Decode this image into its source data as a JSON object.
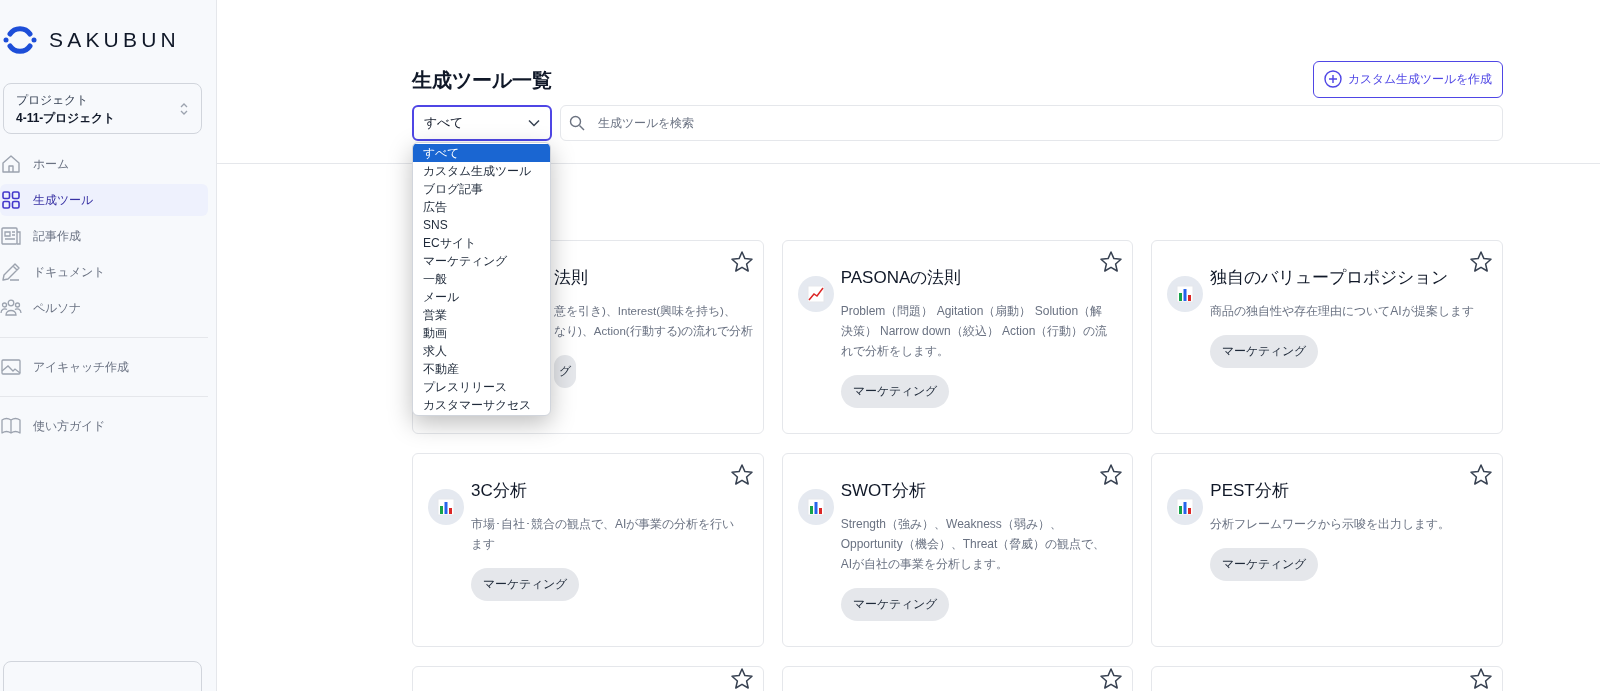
{
  "brand": "SAKUBUN",
  "project": {
    "label": "プロジェクト",
    "value": "4-11-プロジェクト"
  },
  "nav_sections": [
    {
      "items": [
        {
          "label": "ホーム",
          "selected": false
        },
        {
          "label": "生成ツール",
          "selected": true
        },
        {
          "label": "記事作成",
          "selected": false
        },
        {
          "label": "ドキュメント",
          "selected": false
        },
        {
          "label": "ペルソナ",
          "selected": false
        }
      ]
    },
    {
      "items": [
        {
          "label": "アイキャッチ作成",
          "selected": false
        }
      ]
    },
    {
      "items": [
        {
          "label": "使い方ガイド",
          "selected": false
        }
      ]
    }
  ],
  "page_title": "生成ツール一覧",
  "create_button": "カスタム生成ツールを作成",
  "category_select": {
    "value": "すべて",
    "expanded": true,
    "options": [
      {
        "label": "すべて",
        "selected": true
      },
      {
        "label": "カスタム生成ツール",
        "selected": false
      },
      {
        "label": "ブログ記事",
        "selected": false
      },
      {
        "label": "広告",
        "selected": false
      },
      {
        "label": "SNS",
        "selected": false
      },
      {
        "label": "ECサイト",
        "selected": false
      },
      {
        "label": "マーケティング",
        "selected": false
      },
      {
        "label": "一般",
        "selected": false
      },
      {
        "label": "メール",
        "selected": false
      },
      {
        "label": "営業",
        "selected": false
      },
      {
        "label": "動画",
        "selected": false
      },
      {
        "label": "求人",
        "selected": false
      },
      {
        "label": "不動産",
        "selected": false
      },
      {
        "label": "プレスリリース",
        "selected": false
      },
      {
        "label": "カスタマーサクセス",
        "selected": false
      }
    ]
  },
  "search": {
    "placeholder": "生成ツールを検索"
  },
  "cards": [
    {
      "kind": "covered",
      "title": "法則",
      "description": [
        "意を引き)、Interest(興味を持ち)、",
        "なり)、Action(行動する)の流れで分析"
      ],
      "tag": "グ"
    },
    {
      "kind": "trend",
      "title": "PASONAの法則",
      "description": [
        "Problem（問題） Agitation（扇動） Solution（解決策） Narrow down（絞込） Action（行動）の流れで分析をします。"
      ],
      "tag": "マーケティング"
    },
    {
      "kind": "bars",
      "title": "独自のバリュープロポジション",
      "description": [
        "商品の独自性や存在理由についてAIが提案します"
      ],
      "tag": "マーケティング"
    },
    {
      "kind": "bars",
      "title": "3C分析",
      "description": [
        "市場･自社･競合の観点で、AIが事業の分析を行います"
      ],
      "tag": "マーケティング"
    },
    {
      "kind": "bars",
      "title": "SWOT分析",
      "description": [
        "Strength（強み）、Weakness（弱み）、Opportunity（機会）、Threat（脅威）の観点で、AIが自社の事業を分析します。"
      ],
      "tag": "マーケティング"
    },
    {
      "kind": "bars",
      "title": "PEST分析",
      "description": [
        "分析フレームワークから示唆を出力します。"
      ],
      "tag": "マーケティング"
    }
  ]
}
